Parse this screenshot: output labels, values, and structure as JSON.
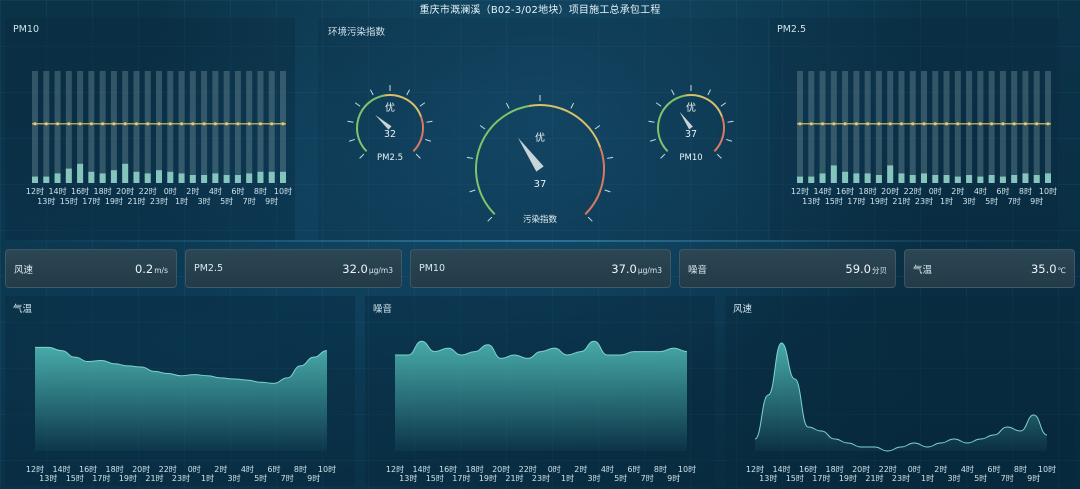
{
  "title": "重庆市溉澜溪（B02-3/02地块）项目施工总承包工程",
  "colors": {
    "accent": "#7fd3cf",
    "line": "#e8c86a",
    "area": "#4ab0ac"
  },
  "hours": [
    "12时",
    "13时",
    "14时",
    "15时",
    "16时",
    "17时",
    "18时",
    "19时",
    "20时",
    "21时",
    "22时",
    "23时",
    "0时",
    "1时",
    "2时",
    "3时",
    "4时",
    "5时",
    "6时",
    "7时",
    "8时",
    "9时",
    "10时"
  ],
  "pm10": {
    "label": "PM10",
    "chart_data": {
      "type": "bar",
      "values": [
        4,
        4,
        6,
        9,
        12,
        7,
        6,
        8,
        12,
        7,
        6,
        8,
        7,
        6,
        5,
        5,
        6,
        5,
        5,
        6,
        7,
        7,
        7
      ],
      "threshold": 37,
      "ylim": [
        0,
        70
      ]
    }
  },
  "pm25": {
    "label": "PM2.5",
    "chart_data": {
      "type": "bar",
      "values": [
        4,
        4,
        6,
        11,
        7,
        6,
        6,
        5,
        11,
        6,
        5,
        6,
        5,
        5,
        4,
        5,
        4,
        5,
        4,
        5,
        6,
        5,
        6
      ],
      "threshold": 37,
      "ylim": [
        0,
        70
      ]
    }
  },
  "env": {
    "label": "环境污染指数",
    "gauge_left": {
      "level": "优",
      "value": "32",
      "name": "PM2.5",
      "num": 32
    },
    "gauge_main": {
      "level": "优",
      "value": "37",
      "name": "污染指数",
      "num": 37
    },
    "gauge_right": {
      "level": "优",
      "value": "37",
      "name": "PM10",
      "num": 37
    }
  },
  "stats": [
    {
      "name": "风速",
      "value": "0.2",
      "unit": "m/s"
    },
    {
      "name": "PM2.5",
      "value": "32.0",
      "unit": "μg/m3"
    },
    {
      "name": "PM10",
      "value": "37.0",
      "unit": "μg/m3"
    },
    {
      "name": "噪音",
      "value": "59.0",
      "unit": "分贝"
    },
    {
      "name": "气温",
      "value": "35.0",
      "unit": "℃"
    }
  ],
  "temp": {
    "label": "气温",
    "chart_data": {
      "type": "area",
      "values": [
        35.5,
        35.5,
        35.2,
        34.6,
        34.2,
        34.3,
        34.0,
        33.8,
        33.7,
        33.3,
        33.1,
        32.9,
        33.0,
        32.9,
        32.7,
        32.6,
        32.5,
        32.3,
        32.2,
        32.7,
        33.8,
        34.6,
        35.2
      ],
      "ylim": [
        26,
        37
      ]
    }
  },
  "noise": {
    "label": "噪音",
    "chart_data": {
      "type": "area",
      "values": [
        58,
        58,
        62,
        59,
        60,
        58,
        59,
        61,
        57,
        58,
        57,
        59,
        60,
        58,
        59,
        62,
        58,
        58,
        59,
        59,
        59,
        60,
        59
      ],
      "ylim": [
        30,
        65
      ]
    }
  },
  "wind": {
    "label": "风速",
    "chart_data": {
      "type": "area",
      "values": [
        0.3,
        1.4,
        2.7,
        1.8,
        0.6,
        0.5,
        0.3,
        0.2,
        0.1,
        0.1,
        0.0,
        0.1,
        0.2,
        0.1,
        0.2,
        0.3,
        0.2,
        0.3,
        0.4,
        0.6,
        0.5,
        0.9,
        0.4
      ],
      "ylim": [
        0,
        3
      ]
    }
  }
}
